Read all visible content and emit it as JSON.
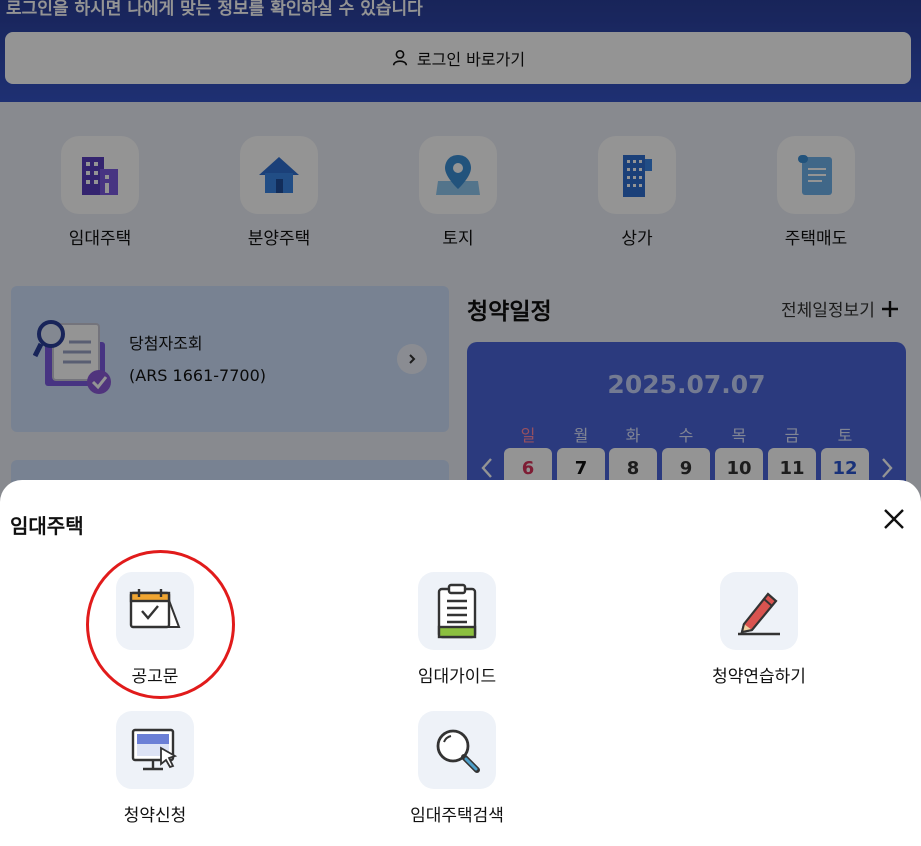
{
  "banner": {
    "text": "로그인을 하시면 나에게 맞는 정보를 확인하실 수 있습니다",
    "login_label": "로그인 바로가기"
  },
  "categories": [
    {
      "label": "임대주택",
      "icon": "rental-housing-icon"
    },
    {
      "label": "분양주택",
      "icon": "sale-housing-icon"
    },
    {
      "label": "토지",
      "icon": "land-icon"
    },
    {
      "label": "상가",
      "icon": "commercial-icon"
    },
    {
      "label": "주택매도",
      "icon": "housing-sale-icon"
    }
  ],
  "result_card": {
    "title": "당첨자조회",
    "subtitle": "(ARS 1661-7700)"
  },
  "schedule": {
    "title": "청약일정",
    "view_all": "전체일정보기",
    "date": "2025.07.07",
    "weekdays": [
      "일",
      "월",
      "화",
      "수",
      "목",
      "금",
      "토"
    ],
    "days": [
      "6",
      "7",
      "8",
      "9",
      "10",
      "11",
      "12"
    ]
  },
  "sheet": {
    "title": "임대주택",
    "items": [
      {
        "label": "공고문",
        "icon": "calendar-check-icon"
      },
      {
        "label": "임대가이드",
        "icon": "clipboard-icon"
      },
      {
        "label": "청약연습하기",
        "icon": "pencil-icon"
      },
      {
        "label": "청약신청",
        "icon": "monitor-click-icon"
      },
      {
        "label": "임대주택검색",
        "icon": "magnifier-icon"
      }
    ]
  },
  "colors": {
    "banner": "#3553c6",
    "calendar": "#4a64d9",
    "sunday": "#d9325a",
    "saturday": "#2a55d0",
    "highlight": "#e11b1b"
  }
}
